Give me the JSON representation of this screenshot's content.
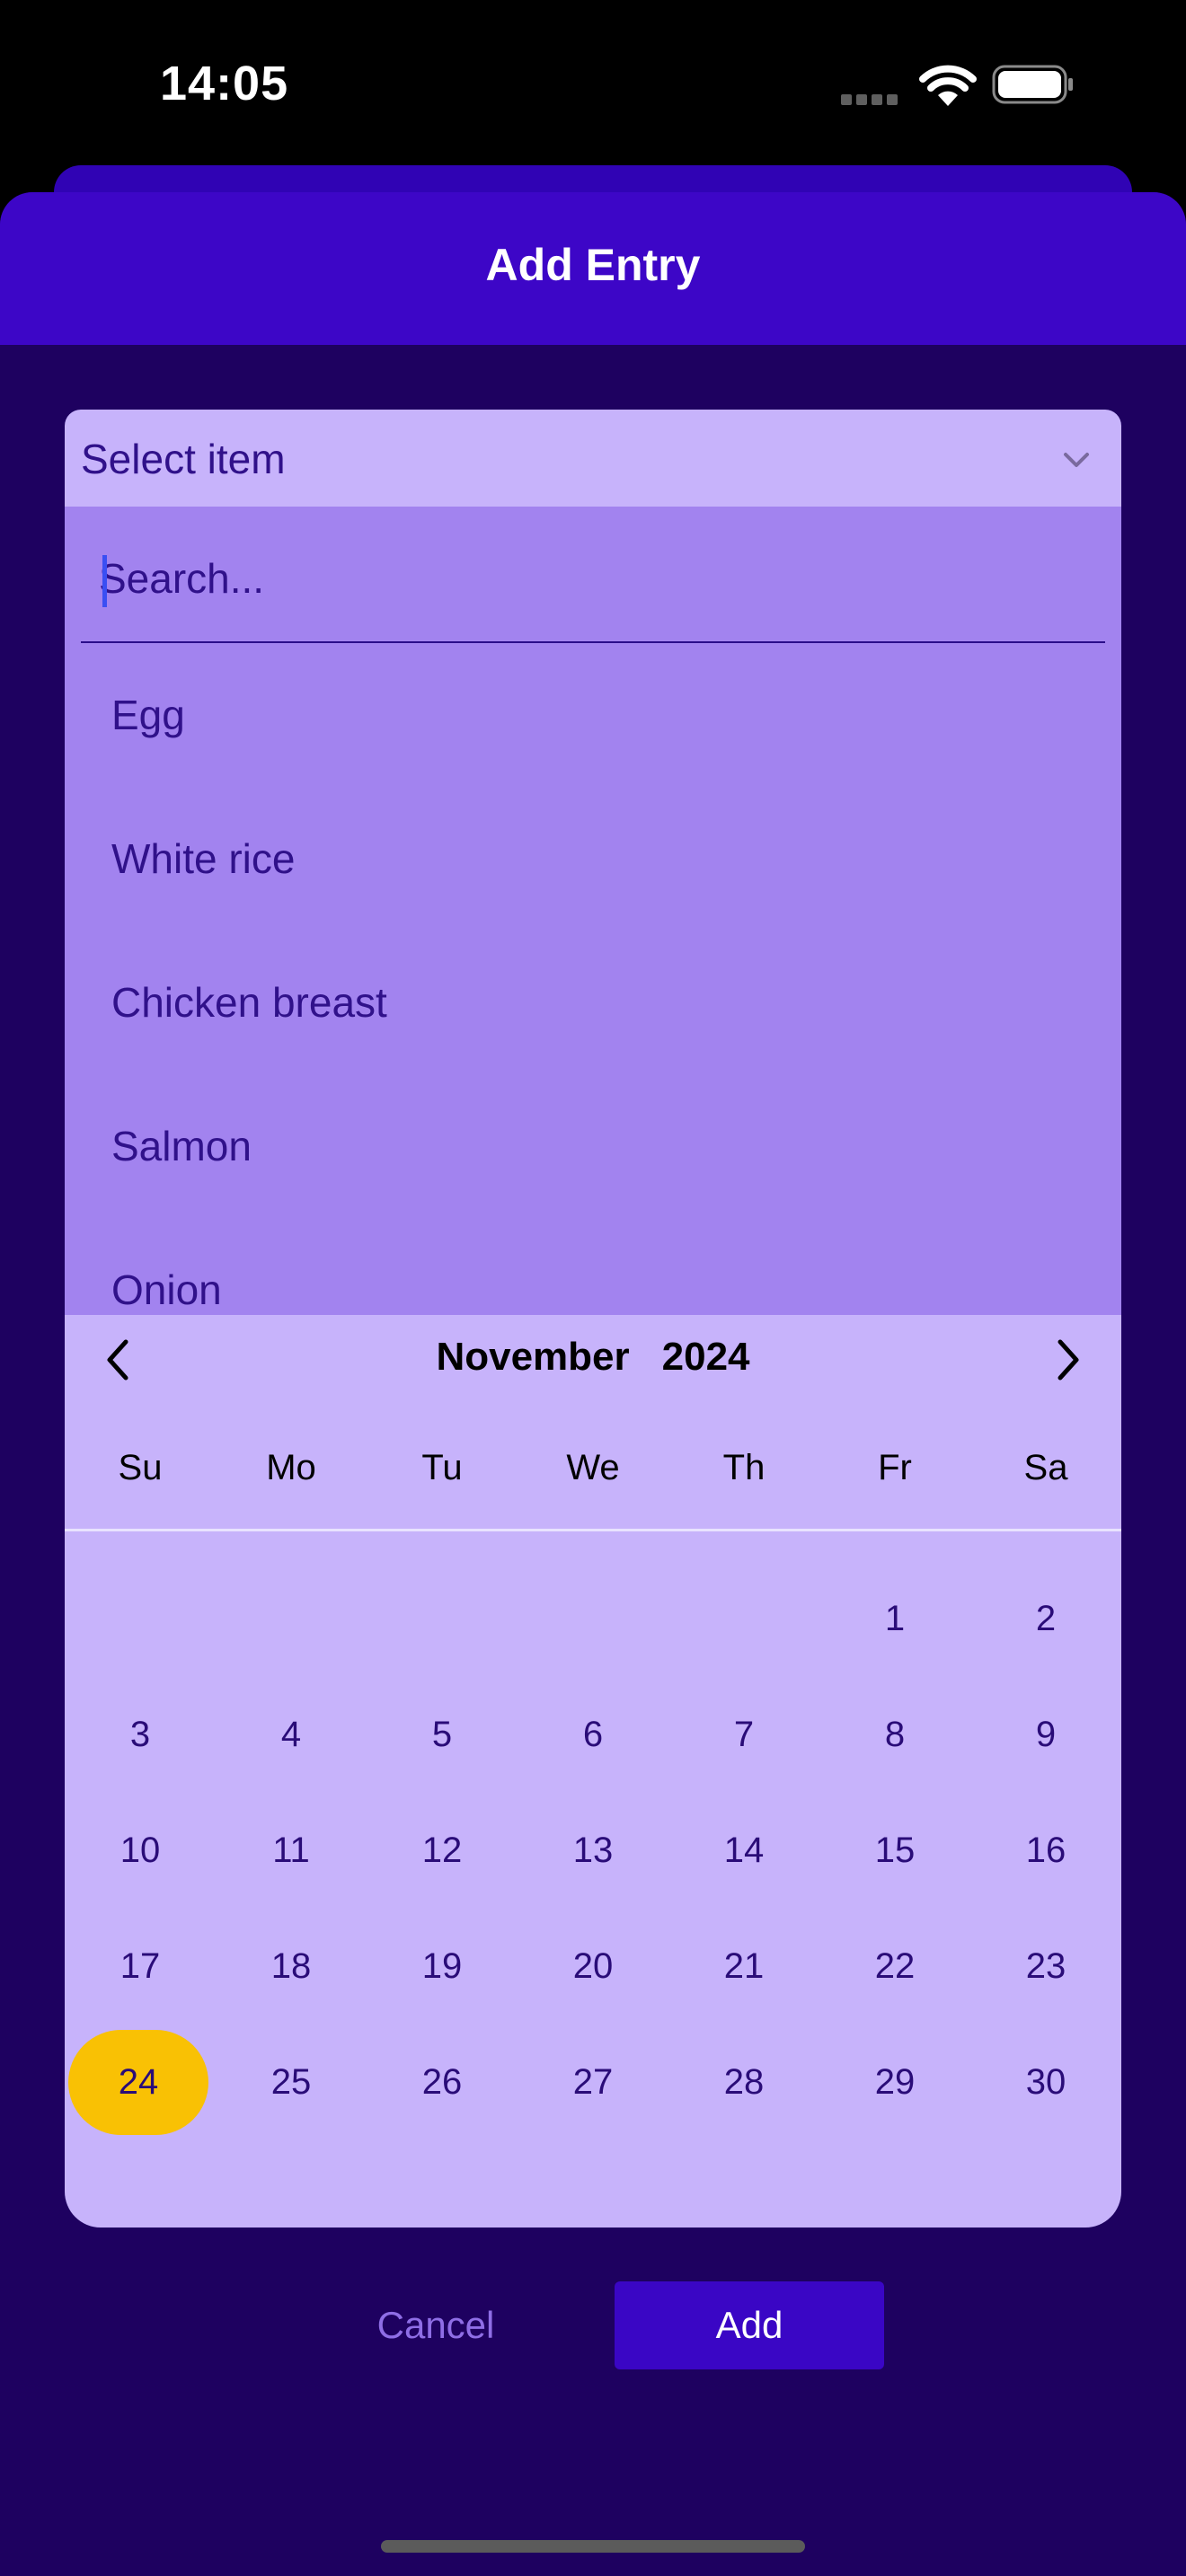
{
  "status_bar": {
    "time": "14:05"
  },
  "modal": {
    "title": "Add Entry"
  },
  "select": {
    "label": "Select item"
  },
  "search": {
    "placeholder": "Search..."
  },
  "options": [
    {
      "label": "Egg"
    },
    {
      "label": "White rice"
    },
    {
      "label": "Chicken breast"
    },
    {
      "label": "Salmon"
    },
    {
      "label": "Onion"
    }
  ],
  "calendar": {
    "month": "November",
    "year": "2024",
    "weekdays": [
      "Su",
      "Mo",
      "Tu",
      "We",
      "Th",
      "Fr",
      "Sa"
    ],
    "weeks": [
      [
        "",
        "",
        "",
        "",
        "",
        "1",
        "2"
      ],
      [
        "3",
        "4",
        "5",
        "6",
        "7",
        "8",
        "9"
      ],
      [
        "10",
        "11",
        "12",
        "13",
        "14",
        "15",
        "16"
      ],
      [
        "17",
        "18",
        "19",
        "20",
        "21",
        "22",
        "23"
      ],
      [
        "24",
        "25",
        "26",
        "27",
        "28",
        "29",
        "30"
      ]
    ],
    "selected_day": "24"
  },
  "actions": {
    "cancel_label": "Cancel",
    "add_label": "Add"
  },
  "colors": {
    "header": "#3d06c7",
    "background": "#1e0160",
    "field": "#c7b3fb",
    "dropdown": "#a283ef",
    "selected_day": "#f9c104",
    "add_button": "#3a06c5"
  }
}
